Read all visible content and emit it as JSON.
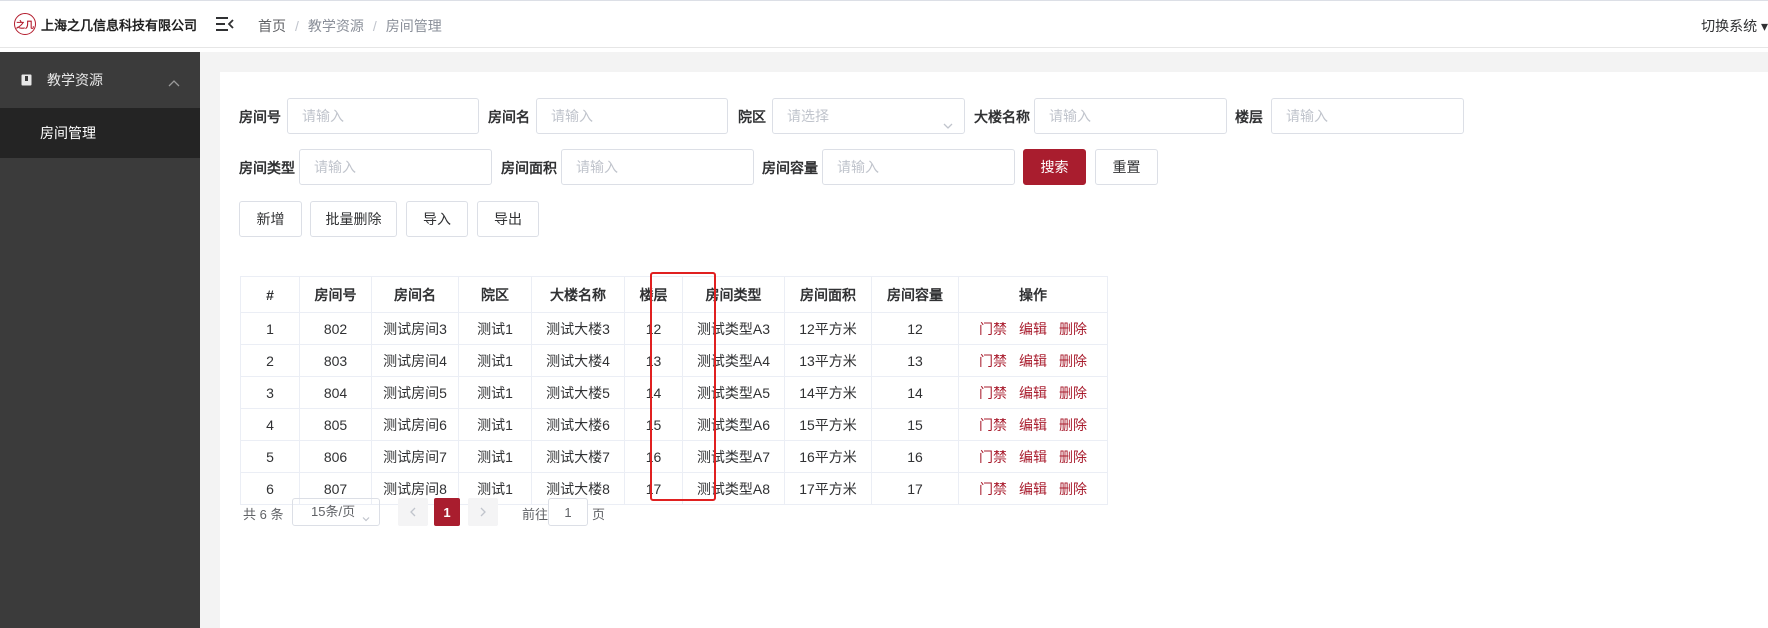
{
  "header": {
    "logo_text": "上海之几信息科技有限公司",
    "logo_mark": "之几",
    "breadcrumb": [
      "首页",
      "教学资源",
      "房间管理"
    ],
    "switch_system": "切换系统"
  },
  "sidebar": {
    "group_label": "教学资源",
    "group_icon": "book-icon",
    "items": [
      {
        "label": "房间管理",
        "active": true
      }
    ]
  },
  "filters": {
    "room_no": {
      "label": "房间号",
      "placeholder": "请输入"
    },
    "room_name": {
      "label": "房间名",
      "placeholder": "请输入"
    },
    "campus": {
      "label": "院区",
      "placeholder": "请选择"
    },
    "building": {
      "label": "大楼名称",
      "placeholder": "请输入"
    },
    "floor": {
      "label": "楼层",
      "placeholder": "请输入"
    },
    "room_type": {
      "label": "房间类型",
      "placeholder": "请输入"
    },
    "room_area": {
      "label": "房间面积",
      "placeholder": "请输入"
    },
    "room_capacity": {
      "label": "房间容量",
      "placeholder": "请输入"
    },
    "search_label": "搜索",
    "reset_label": "重置"
  },
  "toolbar": {
    "add_label": "新增",
    "batch_delete_label": "批量删除",
    "import_label": "导入",
    "export_label": "导出"
  },
  "table": {
    "columns": [
      "#",
      "房间号",
      "房间名",
      "院区",
      "大楼名称",
      "楼层",
      "房间类型",
      "房间面积",
      "房间容量",
      "操作"
    ],
    "rows": [
      [
        "1",
        "802",
        "测试房间3",
        "测试1",
        "测试大楼3",
        "12",
        "测试类型A3",
        "12平方米",
        "12"
      ],
      [
        "2",
        "803",
        "测试房间4",
        "测试1",
        "测试大楼4",
        "13",
        "测试类型A4",
        "13平方米",
        "13"
      ],
      [
        "3",
        "804",
        "测试房间5",
        "测试1",
        "测试大楼5",
        "14",
        "测试类型A5",
        "14平方米",
        "14"
      ],
      [
        "4",
        "805",
        "测试房间6",
        "测试1",
        "测试大楼6",
        "15",
        "测试类型A6",
        "15平方米",
        "15"
      ],
      [
        "5",
        "806",
        "测试房间7",
        "测试1",
        "测试大楼7",
        "16",
        "测试类型A7",
        "16平方米",
        "16"
      ],
      [
        "6",
        "807",
        "测试房间8",
        "测试1",
        "测试大楼8",
        "17",
        "测试类型A8",
        "17平方米",
        "17"
      ]
    ],
    "actions": [
      "门禁",
      "编辑",
      "删除"
    ],
    "highlighted_column": "院区"
  },
  "pagination": {
    "total_text": "共 6 条",
    "page_size": "15条/页",
    "current_page": "1",
    "goto_label": "前往",
    "goto_value": "1",
    "page_suffix": "页"
  },
  "colors": {
    "primary": "#a91d2e",
    "sidebar_bg": "#3b3b3b",
    "sidebar_active_bg": "#242424",
    "highlight_box": "#e02020"
  }
}
